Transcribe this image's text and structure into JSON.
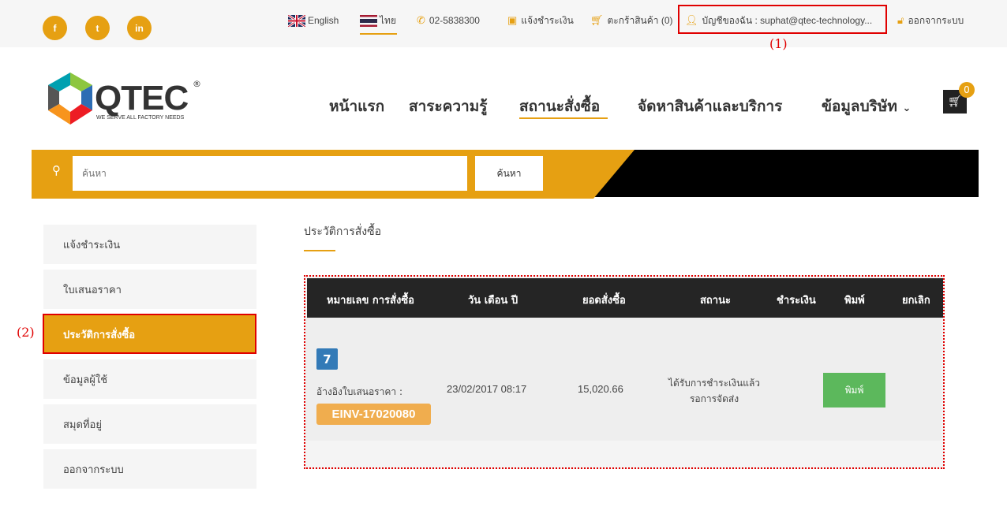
{
  "topbar": {
    "social": [
      {
        "label": "f",
        "icon": "facebook-icon"
      },
      {
        "label": "t",
        "icon": "twitter-icon"
      },
      {
        "label": "in",
        "icon": "linkedin-icon"
      }
    ],
    "english_label": "English",
    "thai_label": "ไทย",
    "phone": "02-5838300",
    "payment_notice": "แจ้งชำระเงิน",
    "cart_label": "ตะกร้าสินค้า (0)",
    "account_label": "บัญชีของฉัน : suphat@qtec-technology...",
    "logout_label": "ออกจากระบบ"
  },
  "annotations": {
    "a1": "(1)",
    "a2": "(2)"
  },
  "brand": {
    "name": "QTEC",
    "tagline": "WE SERVE ALL FACTORY NEEDS",
    "registered": "®"
  },
  "nav": {
    "items": [
      "หน้าแรก",
      "สาระความรู้",
      "สถานะสั่งซื้อ",
      "จัดหาสินค้าและบริการ",
      "ข้อมูลบริษัท"
    ],
    "cart_count": "0"
  },
  "search": {
    "placeholder": "ค้นหา",
    "button_label": "ค้นหา"
  },
  "sidebar": {
    "items": [
      {
        "label": "แจ้งชำระเงิน"
      },
      {
        "label": "ใบเสนอราคา"
      },
      {
        "label": "ประวัติการสั่งซื้อ",
        "active": true
      },
      {
        "label": "ข้อมูลผู้ใช้"
      },
      {
        "label": "สมุดที่อยู่"
      },
      {
        "label": "ออกจากระบบ"
      }
    ]
  },
  "main": {
    "title": "ประวัติการสั่งซื้อ",
    "columns": [
      "หมายเลข การสั่งซื้อ",
      "วัน เดือน ปี",
      "ยอดสั่งซื้อ",
      "สถานะ",
      "ชำระเงิน",
      "พิมพ์",
      "ยกเลิก"
    ],
    "rows": [
      {
        "order_no": "7",
        "ref_label": "อ้างอิงใบเสนอราคา :",
        "ref_code": "EINV-17020080",
        "date": "23/02/2017 08:17",
        "amount": "15,020.66",
        "status_line1": "ได้รับการชำระเงินแล้ว",
        "status_line2": "รอการจัดส่ง",
        "print_label": "พิมพ์"
      }
    ]
  },
  "colors": {
    "accent": "#e6a012",
    "dark": "#252525",
    "annotation": "#e00000",
    "print_button": "#5cb85c",
    "order_badge": "#337ab7",
    "ref_badge": "#f0ad4e"
  }
}
